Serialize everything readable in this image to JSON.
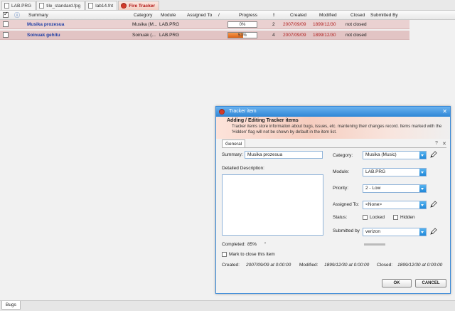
{
  "tabs": [
    {
      "label": "LAB.PRG"
    },
    {
      "label": "tile_standard.fpg"
    },
    {
      "label": "lab14.fnt"
    },
    {
      "label": "Fire Tracker"
    }
  ],
  "table": {
    "headers": {
      "summary": "Summary",
      "category": "Category",
      "module": "Module",
      "assigned_to": "Assigned To",
      "sort_slash": "/",
      "progress": "Progress",
      "priority_bang": "!",
      "created": "Created",
      "modified": "Modified",
      "closed": "Closed",
      "submitted_by": "Submitted By"
    },
    "rows": [
      {
        "summary": "Musika prozesua",
        "category": "Musika (M...",
        "module": "LAB.PRG",
        "progress": 0,
        "progress_label": "0%",
        "priority": "2",
        "created": "2007/09/09",
        "modified": "1899/12/30",
        "closed": "not closed"
      },
      {
        "summary": "Soinuak gehitu",
        "category": "Soinuak (...",
        "module": "LAB.PRG",
        "progress": 0.53,
        "progress_label": "53%",
        "priority": "4",
        "created": "2007/09/09",
        "modified": "1899/12/30",
        "closed": "not closed"
      }
    ]
  },
  "bottom_tab": {
    "label": "Bugs"
  },
  "dialog": {
    "title": "Tracker item",
    "close_glyph": "✕",
    "banner_title": "Adding / Editing Tracker items",
    "banner_text": "Tracker items store information about bugs, issues, etc. mantening their changes record. Items marked with the 'Hidden' flag will not be shown by default in the item list.",
    "general_tab": "General",
    "help_glyph": "?",
    "close_small": "✕",
    "summary_label": "Summary:",
    "summary_value": "Musika prozesua",
    "description_label": "Detailed Description:",
    "category_label": "Category:",
    "category_value": "Musika (Music)",
    "module_label": "Module:",
    "module_value": "LAB.PRG",
    "priority_label": "Priority:",
    "priority_value": "2 - Low",
    "assigned_label": "Assigned To:",
    "assigned_value": "<None>",
    "status_label": "Status:",
    "locked_label": "Locked",
    "hidden_label": "Hidden",
    "submitted_label": "Submitted by",
    "submitted_value": "verizon",
    "completed_label": "Completed:",
    "completed_value": "85%",
    "completed_arrow": "›",
    "mark_close_label": "Mark to close this item",
    "created_label": "Created:",
    "created_value": "2007/09/09 at 0:00:00",
    "modified_label": "Modified:",
    "modified_value": "1899/12/30 at 0:00:00",
    "closed_label": "Closed:",
    "closed_value": "1899/12/30 at 0:00:00",
    "ok_label": "OK",
    "cancel_label": "CANCEL"
  },
  "colors": {
    "accent": "#2f86d6",
    "row_bg": "#ead1d1",
    "progress_fill": "#dd6214",
    "date_red": "#b02020"
  }
}
